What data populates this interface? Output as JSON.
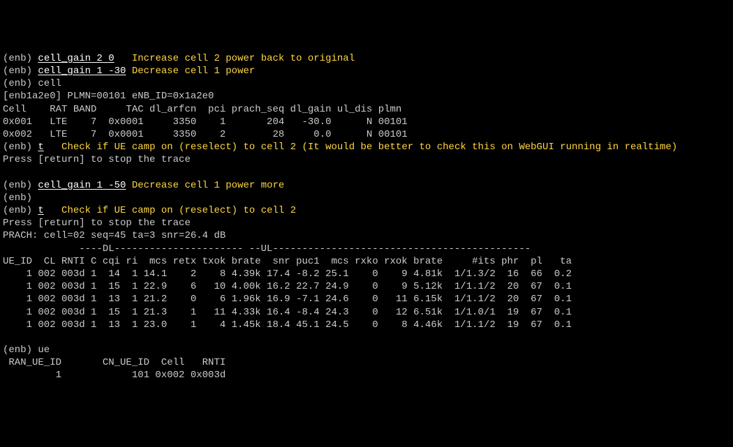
{
  "lines": [
    {
      "prompt": "(enb) ",
      "cmd": "cell_gain 2 0",
      "gap": "   ",
      "note": "Increase cell 2 power back to original"
    },
    {
      "prompt": "(enb) ",
      "cmd": "cell_gain 1 -30",
      "gap": " ",
      "note": "Decrease cell 1 power"
    },
    {
      "text": "(enb) cell"
    },
    {
      "text": "[enb1a2e0] PLMN=00101 eNB_ID=0x1a2e0"
    },
    {
      "text": "Cell    RAT BAND     TAC dl_arfcn  pci prach_seq dl_gain ul_dis plmn"
    },
    {
      "text": "0x001   LTE    7  0x0001     3350    1       204   -30.0      N 00101"
    },
    {
      "text": "0x002   LTE    7  0x0001     3350    2        28     0.0      N 00101"
    },
    {
      "prompt": "(enb) ",
      "cmd": "t",
      "gap": "   ",
      "note": "Check if UE camp on (reselect) to cell 2 (It would be better to check this on WebGUI running in realtime)"
    },
    {
      "text": "Press [return] to stop the trace"
    },
    {
      "text": ""
    },
    {
      "prompt": "(enb) ",
      "cmd": "cell_gain 1 -50",
      "gap": " ",
      "note": "Decrease cell 1 power more"
    },
    {
      "text": "(enb)"
    },
    {
      "prompt": "(enb) ",
      "cmd": "t",
      "gap": "   ",
      "note": "Check if UE camp on (reselect) to cell 2"
    },
    {
      "text": "Press [return] to stop the trace"
    },
    {
      "text": "PRACH: cell=02 seq=45 ta=3 snr=26.4 dB"
    },
    {
      "text": "             ----DL---------------------- --UL--------------------------------------------"
    },
    {
      "text": "UE_ID  CL RNTI C cqi ri  mcs retx txok brate  snr puc1  mcs rxko rxok brate     #its phr  pl   ta"
    },
    {
      "text": "    1 002 003d 1  14  1 14.1    2    8 4.39k 17.4 -8.2 25.1    0    9 4.81k  1/1.3/2  16  66  0.2"
    },
    {
      "text": "    1 002 003d 1  15  1 22.9    6   10 4.00k 16.2 22.7 24.9    0    9 5.12k  1/1.1/2  20  67  0.1"
    },
    {
      "text": "    1 002 003d 1  13  1 21.2    0    6 1.96k 16.9 -7.1 24.6    0   11 6.15k  1/1.1/2  20  67  0.1"
    },
    {
      "text": "    1 002 003d 1  15  1 21.3    1   11 4.33k 16.4 -8.4 24.3    0   12 6.51k  1/1.0/1  19  67  0.1"
    },
    {
      "text": "    1 002 003d 1  13  1 23.0    1    4 1.45k 18.4 45.1 24.5    0    8 4.46k  1/1.1/2  19  67  0.1"
    },
    {
      "text": ""
    },
    {
      "text": "(enb) ue"
    },
    {
      "text": " RAN_UE_ID       CN_UE_ID  Cell   RNTI"
    },
    {
      "text": "         1            101 0x002 0x003d"
    }
  ]
}
